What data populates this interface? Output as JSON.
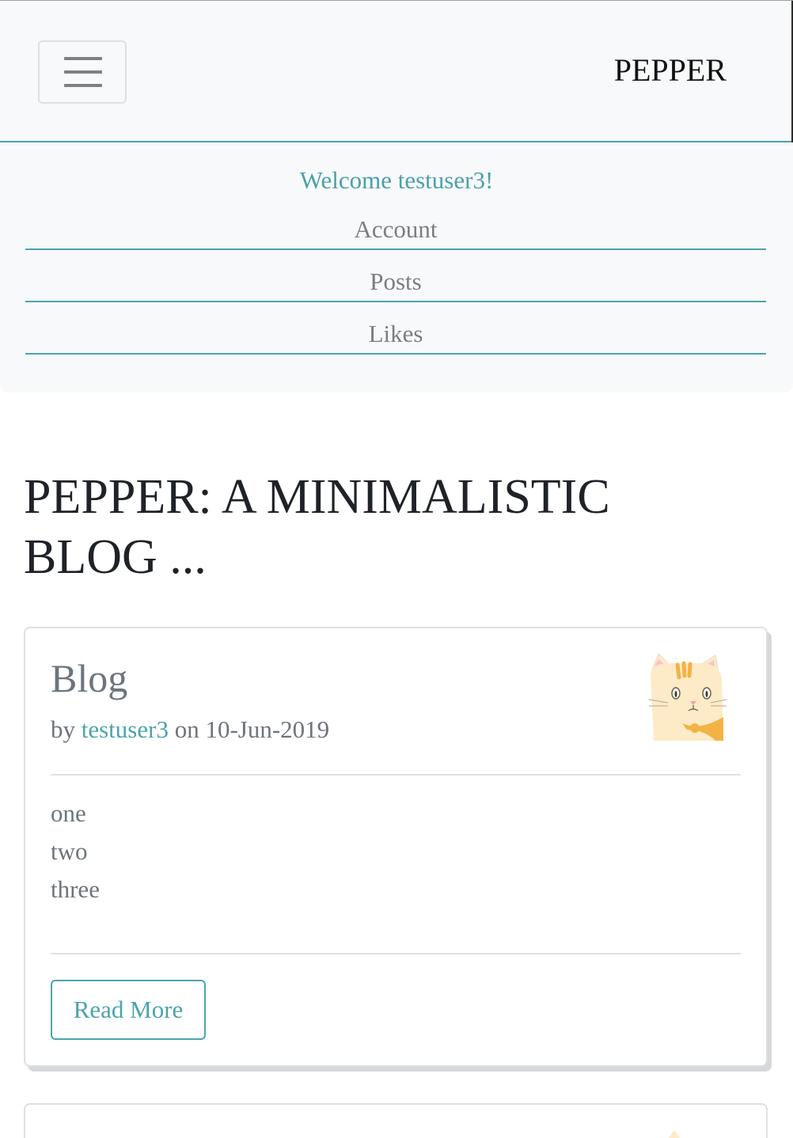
{
  "navbar": {
    "brand": "PEPPER"
  },
  "menu": {
    "welcome": "Welcome testuser3!",
    "items": [
      {
        "label": "Account"
      },
      {
        "label": "Posts"
      },
      {
        "label": "Likes"
      }
    ]
  },
  "main": {
    "heading": "PEPPER: A MINIMALISTIC BLOG ..."
  },
  "post": {
    "title": "Blog",
    "by": "by",
    "author": "testuser3",
    "on": "on",
    "date": "10-Jun-2019",
    "lines": [
      "one",
      "two",
      "three"
    ],
    "read_more": "Read More"
  },
  "colors": {
    "accent": "#4aa3ae",
    "muted": "#6c757d",
    "navbar_bg": "#f8f9fa"
  },
  "icons": {
    "toggler": "hamburger-menu-icon",
    "avatar": "cat-avatar-icon"
  }
}
